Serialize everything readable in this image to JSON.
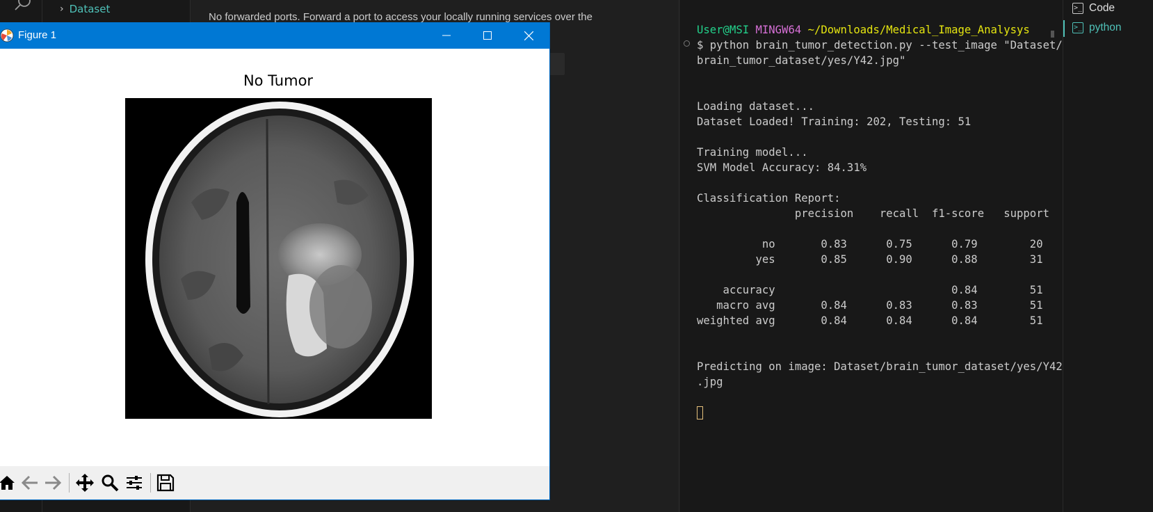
{
  "sidebar": {
    "item_label": "Dataset"
  },
  "ports": {
    "message": "No forwarded ports. Forward a port to access your locally running services over the"
  },
  "terminal": {
    "prompt_user": "User@MSI",
    "prompt_host": "MINGW64",
    "prompt_path": "~/Downloads/Medical_Image_Analysys",
    "lines": [
      "$ python brain_tumor_detection.py --test_image \"Dataset/",
      "brain_tumor_dataset/yes/Y42.jpg\"",
      "",
      "",
      "Loading dataset...",
      "Dataset Loaded! Training: 202, Testing: 51",
      "",
      "Training model...",
      "SVM Model Accuracy: 84.31%",
      "",
      "Classification Report:",
      "               precision    recall  f1-score   support",
      "",
      "          no       0.83      0.75      0.79        20",
      "         yes       0.85      0.90      0.88        31",
      "",
      "    accuracy                           0.84        51",
      "   macro avg       0.84      0.83      0.83        51",
      "weighted avg       0.84      0.84      0.84        51",
      "",
      "",
      "Predicting on image: Dataset/brain_tumor_dataset/yes/Y42",
      ".jpg"
    ]
  },
  "terminal_tabs": [
    {
      "label": "Code",
      "icon": "terminal-icon",
      "active": false
    },
    {
      "label": "python",
      "icon": "terminal-icon",
      "active": true
    }
  ],
  "figure": {
    "window_title": "Figure 1",
    "plot_title": "No Tumor",
    "toolbar": [
      {
        "name": "home-icon"
      },
      {
        "name": "back-arrow-icon"
      },
      {
        "name": "forward-arrow-icon"
      },
      {
        "name": "pan-icon"
      },
      {
        "name": "zoom-icon"
      },
      {
        "name": "configure-subplots-icon"
      },
      {
        "name": "save-icon"
      }
    ]
  },
  "colors": {
    "titlebar": "#0078d4",
    "terminal_bg": "#181818",
    "accent": "#4fc1b8",
    "prompt_user": "#23d18b",
    "prompt_host": "#d670d6",
    "prompt_path": "#e5e510"
  }
}
